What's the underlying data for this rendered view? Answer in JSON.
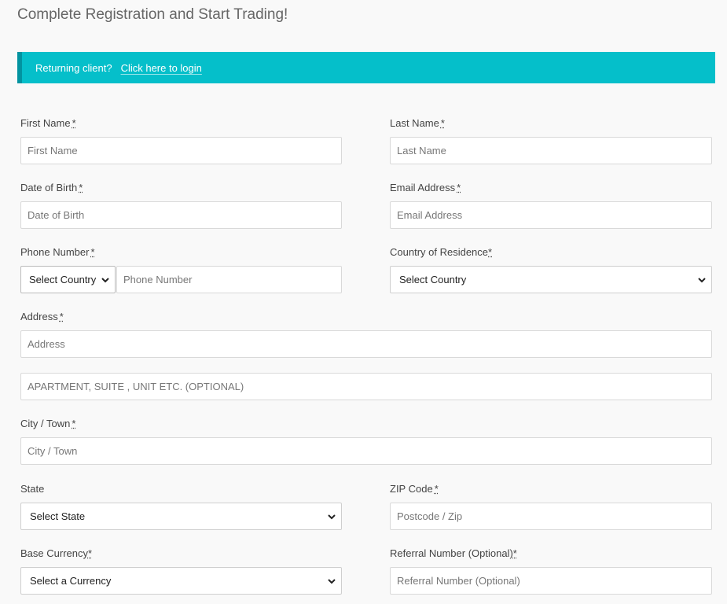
{
  "page": {
    "title": "Complete Registration and Start Trading!"
  },
  "notice": {
    "text": "Returning client?",
    "link": "Click here to login"
  },
  "required_mark": "*",
  "fields": {
    "first_name": {
      "label": "First Name",
      "placeholder": "First Name"
    },
    "last_name": {
      "label": "Last Name",
      "placeholder": "Last Name"
    },
    "dob": {
      "label": "Date of Birth",
      "placeholder": "Date of Birth"
    },
    "email": {
      "label": "Email Address",
      "placeholder": "Email Address"
    },
    "phone": {
      "label": "Phone Number",
      "country_select": "Select Country",
      "placeholder": "Phone Number"
    },
    "country": {
      "label": "Country of Residence",
      "selected": "Select Country"
    },
    "address": {
      "label": "Address",
      "placeholder": "Address",
      "placeholder2": "APARTMENT, SUITE , UNIT ETC. (OPTIONAL)"
    },
    "city": {
      "label": "City / Town",
      "placeholder": "City / Town"
    },
    "state": {
      "label": "State",
      "selected": "Select State"
    },
    "zip": {
      "label": "ZIP Code",
      "placeholder": "Postcode / Zip"
    },
    "currency": {
      "label": "Base Currency",
      "selected": "Select a Currency"
    },
    "referral": {
      "label": "Referral Number (Optional)",
      "placeholder": "Referral Number (Optional)"
    }
  },
  "icons": {
    "dropdown": "chevron-down-icon"
  },
  "colors": {
    "accent": "#05bfca",
    "accent_border": "#0293a0",
    "background": "#f9f9f9"
  }
}
